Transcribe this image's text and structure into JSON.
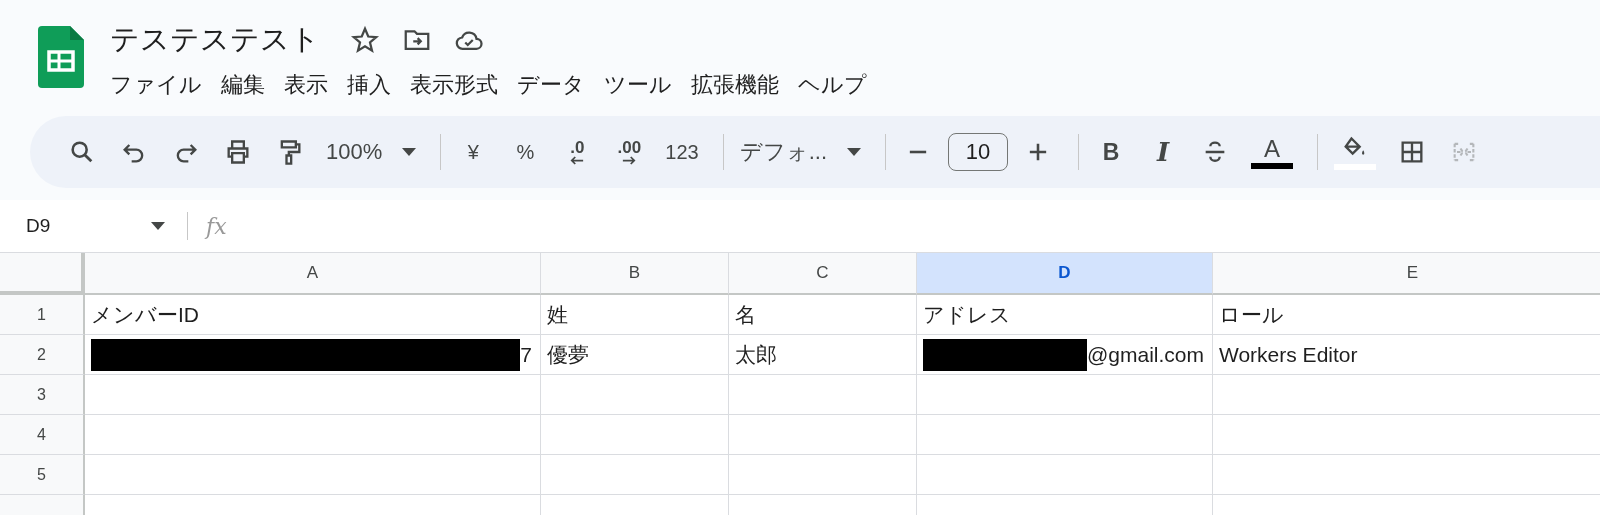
{
  "document": {
    "title": "テステステスト"
  },
  "menu": [
    {
      "label": "ファイル"
    },
    {
      "label": "編集"
    },
    {
      "label": "表示"
    },
    {
      "label": "挿入"
    },
    {
      "label": "表示形式"
    },
    {
      "label": "データ"
    },
    {
      "label": "ツール"
    },
    {
      "label": "拡張機能"
    },
    {
      "label": "ヘルプ"
    }
  ],
  "toolbar": {
    "zoom": "100%",
    "currency": "¥",
    "percent": "%",
    "decrease_decimal": ".0",
    "increase_decimal": ".00",
    "number_format": "123",
    "font": "デフォ...",
    "font_size": "10",
    "bold": "B",
    "italic": "I",
    "text_color": {
      "label": "A",
      "color": "#000000"
    },
    "fill_color": {
      "color": "#ffffff"
    },
    "merge": {
      "disabled": true
    }
  },
  "formula_bar": {
    "name_box": "D9",
    "formula_label": "fx"
  },
  "sheet": {
    "columns": [
      {
        "label": "A",
        "selected": false
      },
      {
        "label": "B",
        "selected": false
      },
      {
        "label": "C",
        "selected": false
      },
      {
        "label": "D",
        "selected": true
      },
      {
        "label": "E",
        "selected": false
      }
    ],
    "rows": [
      {
        "label": "1",
        "cells": [
          {
            "text": "メンバーID"
          },
          {
            "text": "姓"
          },
          {
            "text": "名"
          },
          {
            "text": "アドレス"
          },
          {
            "text": "ロール"
          }
        ]
      },
      {
        "label": "2",
        "cells": [
          {
            "text": "7",
            "redacted": true
          },
          {
            "text": "優夢"
          },
          {
            "text": "太郎"
          },
          {
            "text": "@gmail.com",
            "redacted": true
          },
          {
            "text": "Workers Editor"
          }
        ]
      },
      {
        "label": "3"
      },
      {
        "label": "4"
      },
      {
        "label": "5"
      }
    ]
  }
}
